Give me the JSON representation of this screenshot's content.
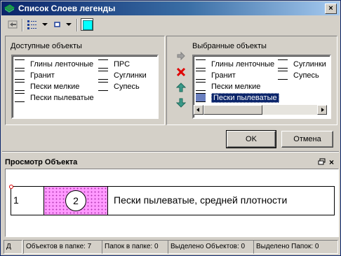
{
  "window": {
    "title": "Список Слоев легенды",
    "close_label": "×"
  },
  "toolbar": {
    "icons": [
      "layer-back-icon",
      "list-view-icon",
      "dropdown-arrow-icon",
      "square-icon",
      "dropdown-arrow-icon",
      "color-swatch-icon"
    ],
    "swatch_color": "#00ffff"
  },
  "available": {
    "label": "Доступные объекты",
    "items": [
      "Глины ленточные",
      "Гранит",
      "Пески мелкие",
      "Пески пылеватые",
      "ПРС",
      "Суглинки",
      "Супесь"
    ]
  },
  "selected": {
    "label": "Выбранные объекты",
    "items": [
      "Глины ленточные",
      "Гранит",
      "Пески мелкие",
      "Пески пылеватые",
      "Суглинки",
      "Супесь"
    ],
    "selected_item": "Пески пылеватые"
  },
  "buttons": {
    "ok": "OK",
    "cancel": "Отмена"
  },
  "preview": {
    "title": "Просмотр Объекта",
    "row_number": "1",
    "circle_number": "2",
    "description": "Пески пылеватые, средней плотности",
    "fill_color": "#ff99ff"
  },
  "statusbar": {
    "d": "Д",
    "objects_in_folder": "Объектов в папке: 7",
    "folders_in_folder": "Папок в папке: 0",
    "selected_objects": "Выделено Объектов: 0",
    "selected_folders": "Выделено Папок: 0"
  }
}
